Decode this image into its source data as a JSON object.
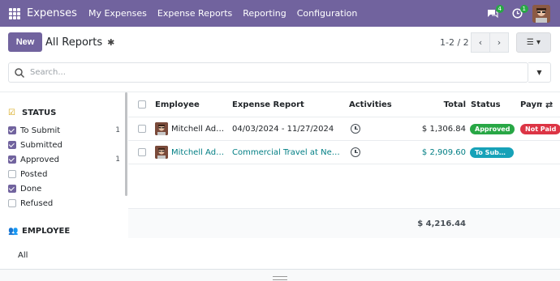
{
  "topbar": {
    "app_name": "Expenses",
    "menu": [
      "My Expenses",
      "Expense Reports",
      "Reporting",
      "Configuration"
    ],
    "messages_count": "4",
    "activities_count": "1"
  },
  "control": {
    "new_label": "New",
    "breadcrumb": "All Reports",
    "pager": "1-2 / 2"
  },
  "search": {
    "placeholder": "Search..."
  },
  "sidebar": {
    "status_header": "STATUS",
    "status_items": [
      {
        "label": "To Submit",
        "checked": true,
        "count": "1"
      },
      {
        "label": "Submitted",
        "checked": true,
        "count": ""
      },
      {
        "label": "Approved",
        "checked": true,
        "count": "1"
      },
      {
        "label": "Posted",
        "checked": false,
        "count": ""
      },
      {
        "label": "Done",
        "checked": true,
        "count": ""
      },
      {
        "label": "Refused",
        "checked": false,
        "count": ""
      }
    ],
    "employee_header": "EMPLOYEE",
    "employee_all": "All"
  },
  "list": {
    "headers": {
      "employee": "Employee",
      "report": "Expense Report",
      "activities": "Activities",
      "total": "Total",
      "status": "Status",
      "payment": "Payment"
    },
    "rows": [
      {
        "employee": "Mitchell Admin",
        "report": "04/03/2024 - 11/27/2024",
        "total": "$ 1,306.84",
        "status": "Approved",
        "payment": "Not Paid"
      },
      {
        "employee": "Mitchell Admin",
        "report": "Commercial Travel at New York",
        "total": "$ 2,909.60",
        "status": "To Submit",
        "payment": ""
      }
    ],
    "grand_total": "$ 4,216.44"
  },
  "colors": {
    "brand": "#71639e",
    "approved": "#28a745",
    "not_paid": "#dc3545",
    "to_submit": "#17a2b8",
    "link": "#017e84"
  }
}
